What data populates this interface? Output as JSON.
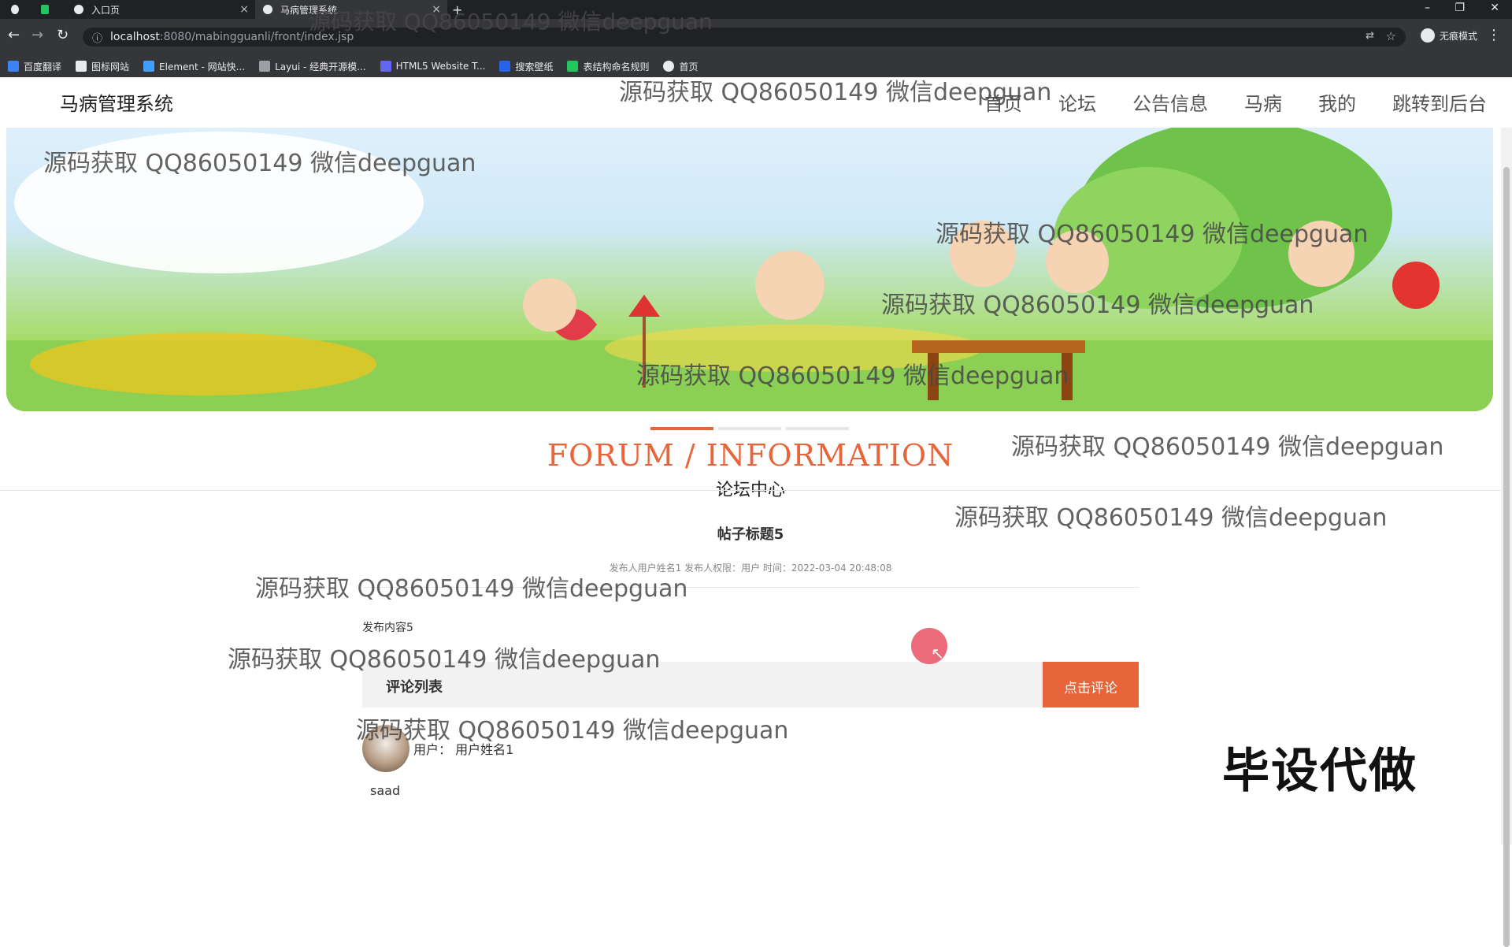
{
  "browser": {
    "tabs": [
      {
        "label": ""
      },
      {
        "label": ""
      },
      {
        "label": "入口页"
      },
      {
        "label": "马病管理系统"
      }
    ],
    "new_tab": "+",
    "url_host": "localhost",
    "url_path": ":8080/mabingguanli/front/index.jsp",
    "incognito": "无痕模式",
    "bookmarks": [
      {
        "label": "百度翻译",
        "color": "#3b82f6"
      },
      {
        "label": "图标网站",
        "color": "#e8eaed"
      },
      {
        "label": "Element - 网站快...",
        "color": "#409eff"
      },
      {
        "label": "Layui - 经典开源模...",
        "color": "#9aa0a6"
      },
      {
        "label": "HTML5 Website T...",
        "color": "#6366f1"
      },
      {
        "label": "搜索壁纸",
        "color": "#2563eb"
      },
      {
        "label": "表结构命名规则",
        "color": "#22c55e"
      },
      {
        "label": "首页",
        "color": "#e8eaed"
      }
    ]
  },
  "site": {
    "title": "马病管理系统",
    "nav": [
      "首页",
      "论坛",
      "公告信息",
      "马病",
      "我的",
      "跳转到后台"
    ]
  },
  "forum": {
    "en_title": "FORUM / INFORMATION",
    "cn_title": "论坛中心"
  },
  "post": {
    "title": "帖子标题5",
    "meta": "发布人用户姓名1   发布人权限：用户   时间：2022-03-04 20:48:08",
    "content": "发布内容5"
  },
  "comments": {
    "header": "评论列表",
    "button": "点击评论",
    "items": [
      {
        "user": "用户：  用户姓名1",
        "text": "saad"
      }
    ]
  },
  "promo": "毕设代做",
  "watermark": "源码获取 QQ86050149 微信deepguan",
  "colors": {
    "accent": "#e8643a",
    "cursor_highlight": "#ea5b6b"
  }
}
